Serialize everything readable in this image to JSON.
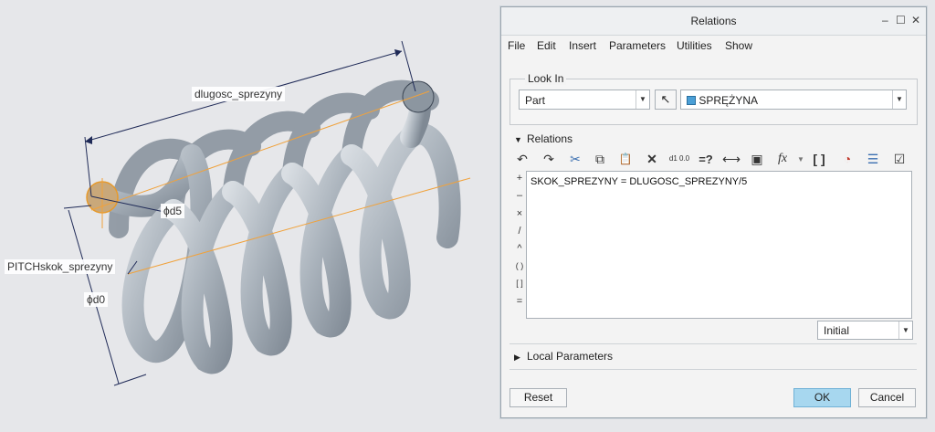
{
  "viewport": {
    "dims": {
      "length": "dlugosc_sprezyny",
      "d5": "ϕd5",
      "pitch": "PITCHskok_sprezyny",
      "d0": "ϕd0"
    }
  },
  "dialog": {
    "title": "Relations",
    "window_controls": {
      "minimize": "–",
      "maximize": "☐",
      "close": "✕"
    },
    "menu": [
      "File",
      "Edit",
      "Insert",
      "Parameters",
      "Utilities",
      "Show"
    ],
    "look_in": {
      "label": "Look In",
      "type_value": "Part",
      "model_value": "SPRĘŻYNA"
    },
    "relations": {
      "label": "Relations",
      "operators": [
        "+",
        "–",
        "×",
        "/",
        "^",
        "( )",
        "[ ]",
        "="
      ],
      "text": "SKOK_SPREZYNY = DLUGOSC_SPREZYNY/5",
      "sort_value": "Initial"
    },
    "local_parameters": {
      "label": "Local Parameters"
    },
    "buttons": {
      "reset": "Reset",
      "ok": "OK",
      "cancel": "Cancel"
    },
    "toolbar": {
      "undo": "↶",
      "redo": "↷",
      "cut": "✂",
      "copy": "⧉",
      "paste": "📋",
      "delete": "✕",
      "evaluate": "d1 0.0",
      "verify": "=?",
      "dimension": "⟷",
      "select": "▣",
      "function": "fx",
      "brackets": "[ ]",
      "sort": "◔",
      "toggle": "☰",
      "check": "☑"
    },
    "colors": {
      "ok_button": "#a7d7ef",
      "spring": "#b6bec6",
      "dimension_line": "#1f2a57",
      "axis": "#f0a23c"
    }
  }
}
